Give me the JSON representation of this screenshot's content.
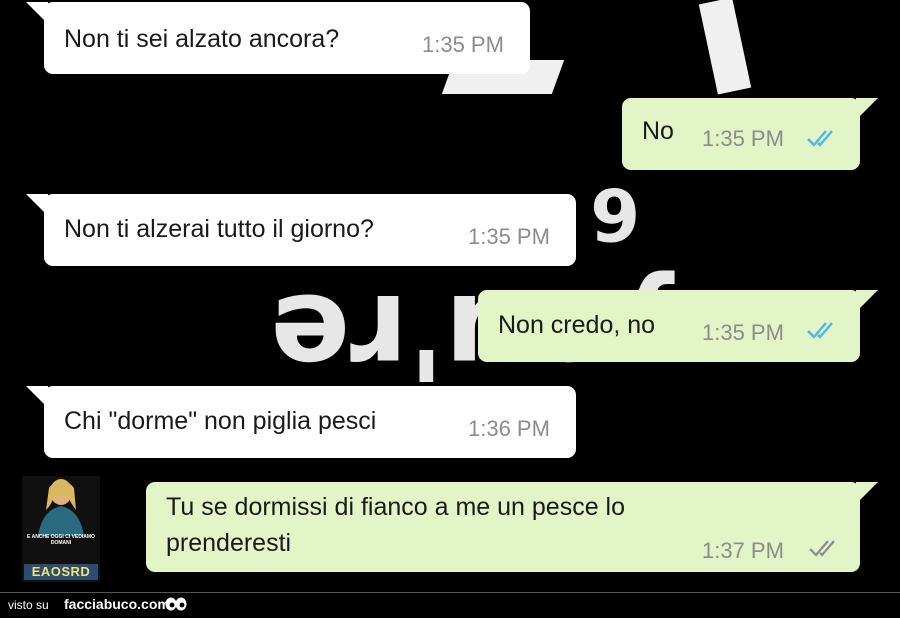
{
  "messages": [
    {
      "direction": "incoming",
      "text": "Non ti sei alzato ancora?",
      "time": "1:35 PM"
    },
    {
      "direction": "outgoing",
      "text": "No",
      "time": "1:35 PM",
      "status": "read"
    },
    {
      "direction": "incoming",
      "text": "Non ti alzerai tutto il giorno?",
      "time": "1:35 PM"
    },
    {
      "direction": "outgoing",
      "text": "Non credo, no",
      "time": "1:35 PM",
      "status": "read"
    },
    {
      "direction": "incoming",
      "text": "Chi \"dorme\" non piglia pesci",
      "time": "1:36 PM"
    },
    {
      "direction": "outgoing",
      "text_line1": "Tu se dormissi di fianco a me un pesce lo",
      "text_line2": "prenderesti",
      "time": "1:37 PM",
      "status": "delivered"
    }
  ],
  "background_text": [
    "6",
    "you're"
  ],
  "watermark": {
    "visto": "visto su",
    "site": "facciabuco.com",
    "thumb_caption": "e anche oggi ci vediamo domani",
    "thumb_tag": "EAOSRD"
  },
  "colors": {
    "incoming_bubble": "#ffffff",
    "outgoing_bubble": "#e1f5c7",
    "read_ticks": "#4fb6ec",
    "delivered_ticks": "#8c8c8c",
    "background": "#000000"
  },
  "icons": {
    "read_receipt": "double-check-icon",
    "eyes": "eyes-icon"
  }
}
